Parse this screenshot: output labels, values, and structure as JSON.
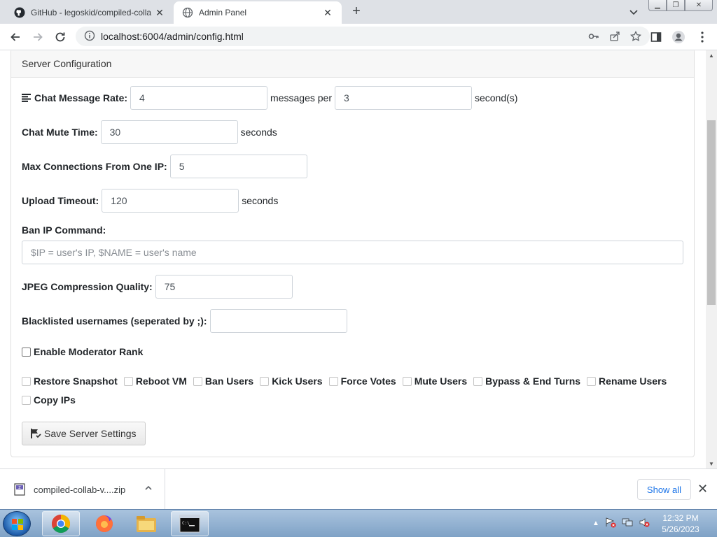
{
  "browser": {
    "tabs": [
      {
        "title": "GitHub - legoskid/compiled-colla",
        "active": false
      },
      {
        "title": "Admin Panel",
        "active": true
      }
    ],
    "url": "localhost:6004/admin/config.html"
  },
  "page": {
    "card_title": "Server Configuration",
    "chat_rate": {
      "label": "Chat Message Rate:",
      "value": "4",
      "middle_text": "messages per",
      "value2": "3",
      "suffix": "second(s)"
    },
    "mute_time": {
      "label": "Chat Mute Time:",
      "value": "30",
      "suffix": "seconds"
    },
    "max_conn": {
      "label": "Max Connections From One IP:",
      "value": "5"
    },
    "upload_timeout": {
      "label": "Upload Timeout:",
      "value": "120",
      "suffix": "seconds"
    },
    "ban_ip": {
      "label": "Ban IP Command:",
      "placeholder": "$IP = user's IP, $NAME = user's name"
    },
    "jpeg_quality": {
      "label": "JPEG Compression Quality:",
      "value": "75"
    },
    "blacklist": {
      "label": "Blacklisted usernames (seperated by ;):",
      "value": ""
    },
    "enable_mod": {
      "label": "Enable Moderator Rank",
      "checked": false
    },
    "permissions": [
      {
        "label": "Restore Snapshot"
      },
      {
        "label": "Reboot VM"
      },
      {
        "label": "Ban Users"
      },
      {
        "label": "Kick Users"
      },
      {
        "label": "Force Votes"
      },
      {
        "label": "Mute Users"
      },
      {
        "label": "Bypass & End Turns"
      },
      {
        "label": "Rename Users"
      },
      {
        "label": "Copy IPs"
      }
    ],
    "save_button": "Save Server Settings"
  },
  "downloads": {
    "file": "compiled-collab-v....zip",
    "show_all": "Show all"
  },
  "taskbar": {
    "time": "12:32 PM",
    "date": "5/26/2023"
  },
  "colors": {
    "accent": "#1a73e8",
    "card_header_bg": "#f7f7f7"
  }
}
